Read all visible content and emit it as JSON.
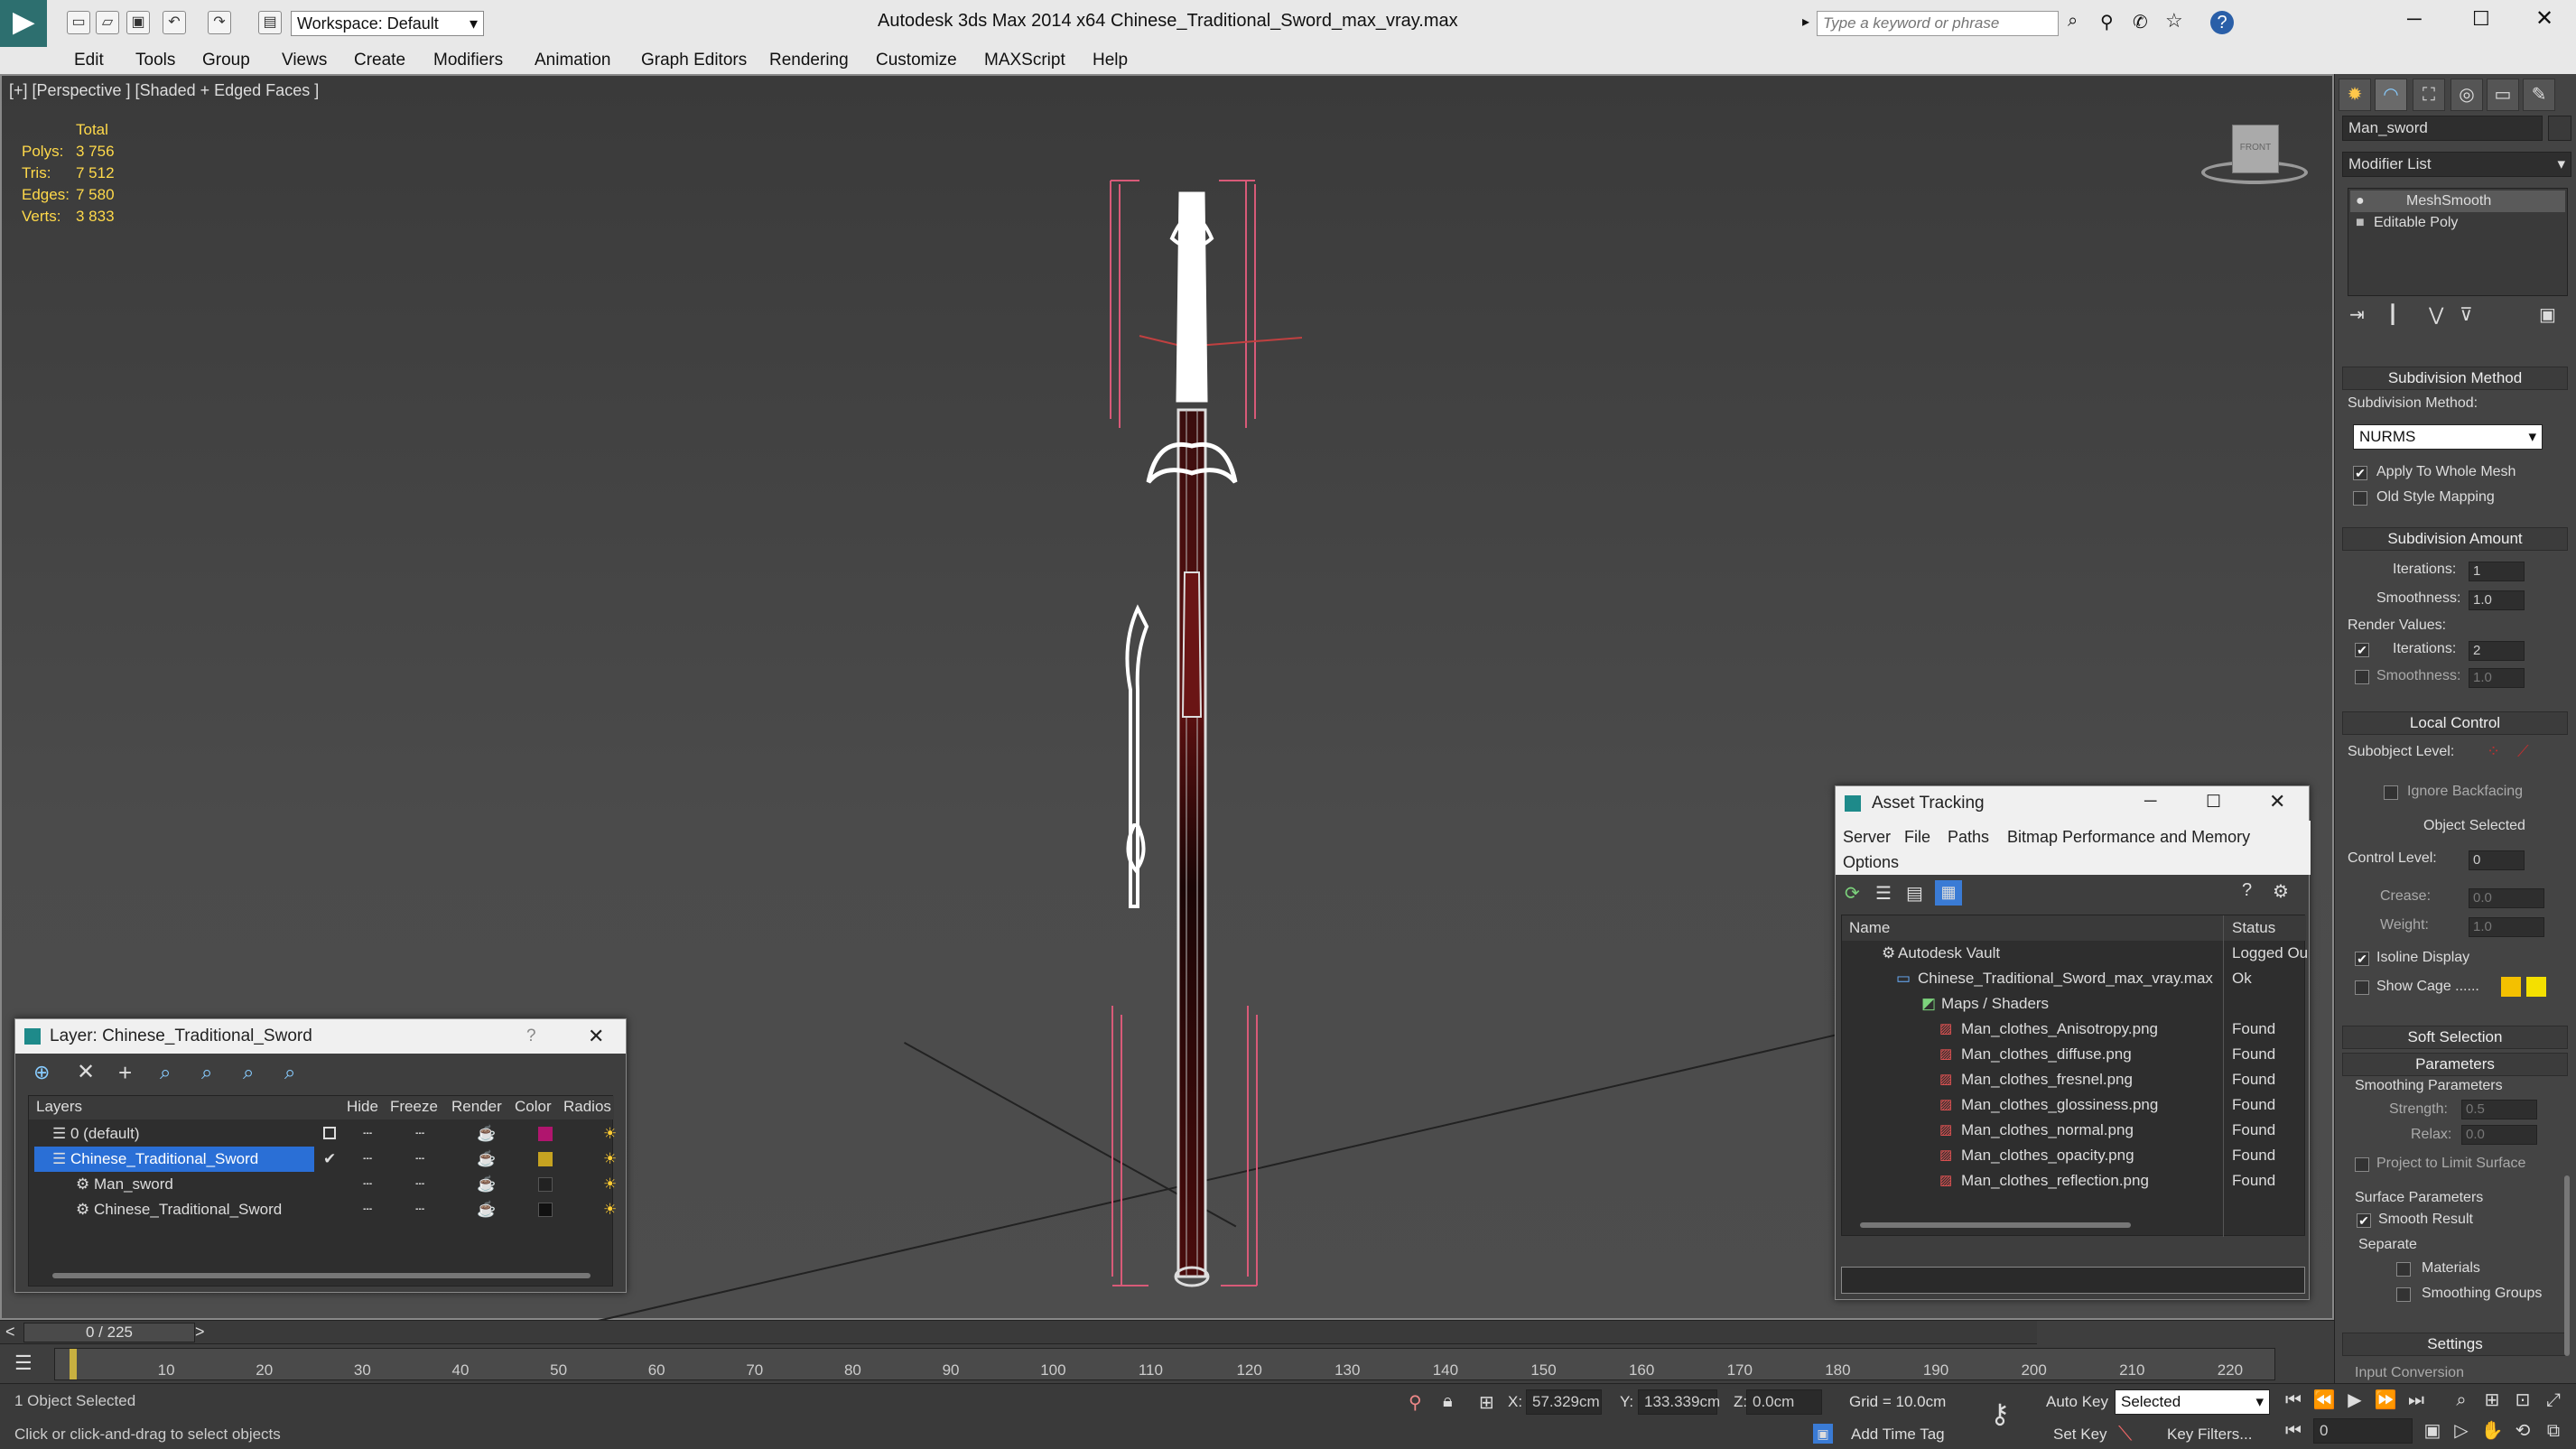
{
  "titlebar": {
    "workspace": "Workspace: Default",
    "app_title": "Autodesk 3ds Max  2014 x64",
    "file_name": "Chinese_Traditional_Sword_max_vray.max",
    "search_placeholder": "Type a keyword or phrase"
  },
  "menu": [
    "Edit",
    "Tools",
    "Group",
    "Views",
    "Create",
    "Modifiers",
    "Animation",
    "Graph Editors",
    "Rendering",
    "Customize",
    "MAXScript",
    "Help"
  ],
  "viewport": {
    "label": "[+] [Perspective ] [Shaded + Edged Faces ]",
    "stats": {
      "total_label": "Total",
      "polys_label": "Polys:",
      "polys": "3 756",
      "tris_label": "Tris:",
      "tris": "7 512",
      "edges_label": "Edges:",
      "edges": "7 580",
      "verts_label": "Verts:",
      "verts": "3 833"
    },
    "viewcube_label": "FRONT"
  },
  "layer_window": {
    "title": "Layer: Chinese_Traditional_Sword",
    "columns": [
      "Layers",
      "Hide",
      "Freeze",
      "Render",
      "Color",
      "Radios"
    ],
    "rows": [
      {
        "name": "0 (default)",
        "color": "#b0156e"
      },
      {
        "name": "Chinese_Traditional_Sword",
        "color": "#c6a321",
        "selected": true
      },
      {
        "name": "Man_sword",
        "color": "#222222"
      },
      {
        "name": "Chinese_Traditional_Sword",
        "color": "#111111"
      }
    ]
  },
  "asset_window": {
    "title": "Asset Tracking",
    "menu": [
      "Server",
      "File",
      "Paths",
      "Bitmap Performance and Memory",
      "Options"
    ],
    "columns": [
      "Name",
      "Status"
    ],
    "rows": [
      {
        "name": "Autodesk Vault",
        "status": "Logged Ou"
      },
      {
        "name": "Chinese_Traditional_Sword_max_vray.max",
        "status": "Ok"
      },
      {
        "name": "Maps / Shaders",
        "status": ""
      },
      {
        "name": "Man_clothes_Anisotropy.png",
        "status": "Found"
      },
      {
        "name": "Man_clothes_diffuse.png",
        "status": "Found"
      },
      {
        "name": "Man_clothes_fresnel.png",
        "status": "Found"
      },
      {
        "name": "Man_clothes_glossiness.png",
        "status": "Found"
      },
      {
        "name": "Man_clothes_normal.png",
        "status": "Found"
      },
      {
        "name": "Man_clothes_opacity.png",
        "status": "Found"
      },
      {
        "name": "Man_clothes_reflection.png",
        "status": "Found"
      }
    ]
  },
  "command_panel": {
    "object_name": "Man_sword",
    "modifier_list": "Modifier List",
    "stack": [
      "MeshSmooth",
      "Editable Poly"
    ],
    "subdivision_method_rollout": "Subdivision Method",
    "subdivision_method_label": "Subdivision Method:",
    "subdivision_method_value": "NURMS",
    "apply_whole_mesh": "Apply To Whole Mesh",
    "old_style_mapping": "Old Style Mapping",
    "subdivision_amount_rollout": "Subdivision Amount",
    "iterations_label": "Iterations:",
    "iterations": "1",
    "smoothness_label": "Smoothness:",
    "smoothness": "1.0",
    "render_values_label": "Render Values:",
    "render_iterations": "2",
    "render_smoothness": "1.0",
    "local_control_rollout": "Local Control",
    "subobject_level_label": "Subobject Level:",
    "ignore_backfacing": "Ignore Backfacing",
    "object_selected": "Object Selected",
    "control_level_label": "Control Level:",
    "control_level": "0",
    "crease_label": "Crease:",
    "crease": "0.0",
    "weight_label": "Weight:",
    "weight": "1.0",
    "isoline_display": "Isoline Display",
    "show_cage": "Show Cage ......",
    "soft_selection_rollout": "Soft Selection",
    "parameters_rollout": "Parameters",
    "smoothing_parameters": "Smoothing Parameters",
    "strength_label": "Strength:",
    "strength": "0.5",
    "relax_label": "Relax:",
    "relax": "0.0",
    "project_limit": "Project to Limit Surface",
    "surface_parameters": "Surface Parameters",
    "smooth_result": "Smooth Result",
    "separate": "Separate",
    "materials": "Materials",
    "smoothing_groups": "Smoothing Groups",
    "settings_rollout": "Settings",
    "input_conversion": "Input Conversion"
  },
  "timeline": {
    "frame_counter": "0 / 225",
    "ticks": [
      "10",
      "20",
      "30",
      "40",
      "50",
      "60",
      "70",
      "80",
      "90",
      "100",
      "110",
      "120",
      "130",
      "140",
      "150",
      "160",
      "170",
      "180",
      "190",
      "200",
      "210",
      "220"
    ]
  },
  "status": {
    "selection": "1 Object Selected",
    "prompt": "Click or click-and-drag to select objects",
    "x_label": "X:",
    "x": "57.329cm",
    "y_label": "Y:",
    "y": "133.339cm",
    "z_label": "Z:",
    "z": "0.0cm",
    "grid": "Grid = 10.0cm",
    "add_time_tag": "Add Time Tag",
    "auto_key": "Auto Key",
    "auto_key_mode": "Selected",
    "set_key": "Set Key",
    "key_filters": "Key Filters...",
    "current_frame": "0"
  }
}
